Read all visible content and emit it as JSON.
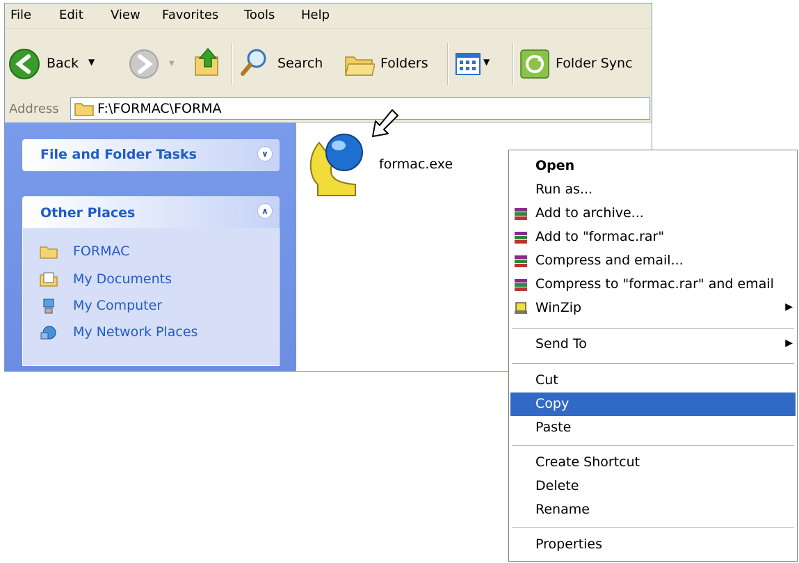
{
  "menu": {
    "items": [
      "File",
      "Edit",
      "View",
      "Favorites",
      "Tools",
      "Help"
    ]
  },
  "toolbar": {
    "back_label": "Back",
    "search_label": "Search",
    "folders_label": "Folders",
    "foldersync_label": "Folder Sync"
  },
  "address": {
    "label": "Address",
    "path": "F:\\FORMAC\\FORMA"
  },
  "tasks": {
    "file_folder_tasks_title": "File and Folder Tasks",
    "other_places_title": "Other Places",
    "places": [
      "FORMAC",
      "My Documents",
      "My Computer",
      "My Network Places"
    ]
  },
  "file": {
    "name": "formac.exe"
  },
  "context_menu": {
    "items": [
      {
        "label": "Open",
        "icon": "",
        "bold": true
      },
      {
        "label": "Run as...",
        "icon": ""
      },
      {
        "label": "Add to archive...",
        "icon": "winrar-icon"
      },
      {
        "label": "Add to \"formac.rar\"",
        "icon": "winrar-icon"
      },
      {
        "label": "Compress and email...",
        "icon": "winrar-icon"
      },
      {
        "label": "Compress to \"formac.rar\" and email",
        "icon": "winrar-icon"
      },
      {
        "label": "WinZip",
        "icon": "winzip-icon",
        "submenu": true
      },
      {
        "label": "Send To",
        "icon": "",
        "submenu": true
      },
      {
        "label": "Cut",
        "icon": ""
      },
      {
        "label": "Copy",
        "icon": "",
        "highlighted": true
      },
      {
        "label": "Paste",
        "icon": ""
      },
      {
        "label": "Create Shortcut",
        "icon": ""
      },
      {
        "label": "Delete",
        "icon": ""
      },
      {
        "label": "Rename",
        "icon": ""
      },
      {
        "label": "Properties",
        "icon": ""
      }
    ]
  },
  "colors": {
    "highlight": "#316ac5",
    "task_pane": "#6c8ee2",
    "task_link": "#215dc6"
  }
}
